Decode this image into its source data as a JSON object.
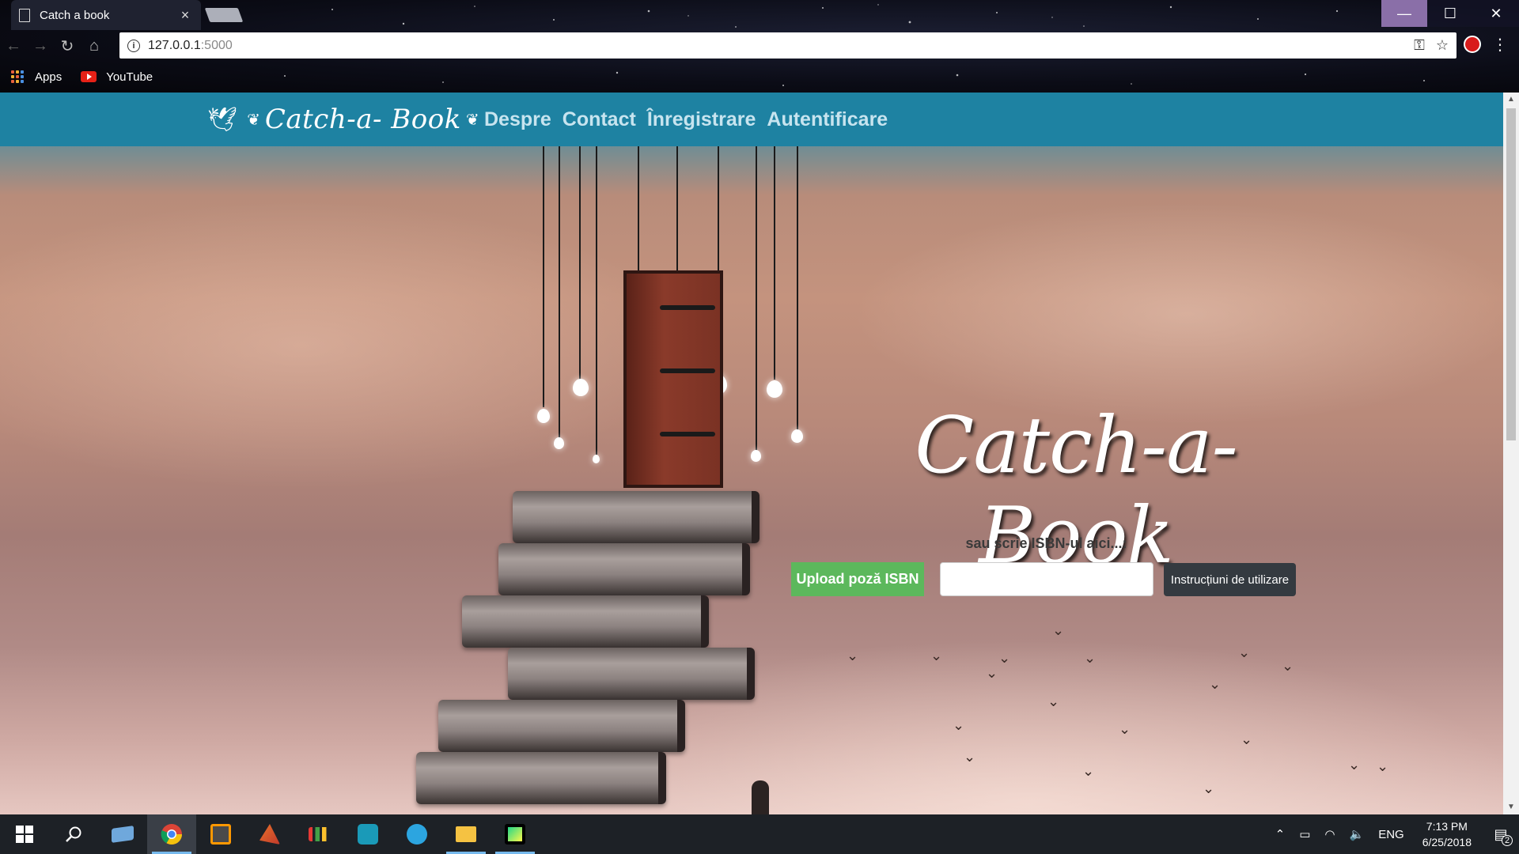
{
  "browser": {
    "tab_title": "Catch a book",
    "tab_close": "×",
    "url_host": "127.0.0.1",
    "url_port": ":5000",
    "window_controls": {
      "minimize": "—",
      "maximize": "☐",
      "close": "✕"
    },
    "bookmarks": [
      {
        "label": "Apps",
        "icon": "apps-grid-icon"
      },
      {
        "label": "YouTube",
        "icon": "youtube-icon"
      }
    ]
  },
  "site": {
    "logo_text": "Catch-a- Book",
    "nav": [
      "Despre",
      "Contact",
      "Înregistrare",
      "Autentificare"
    ],
    "hero_title": "Catch-a-Book",
    "isbn_hint": "sau scrie ISBN-ul aici...:",
    "upload_button": "Upload poză ISBN",
    "isbn_input_value": "",
    "help_button": "Instrucțiuni de utilizare"
  },
  "taskbar": {
    "apps": [
      "start",
      "search",
      "task-view",
      "chrome",
      "sublime-text",
      "matlab",
      "chart-app",
      "instagram",
      "telegram",
      "file-explorer",
      "pycharm"
    ],
    "language": "ENG",
    "time": "7:13 PM",
    "date": "6/25/2018",
    "notification_count": "2"
  },
  "colors": {
    "navbar": "#1e82a2",
    "upload_button": "#5cb85c",
    "help_button": "#343a40",
    "taskbar": "#1d2126"
  }
}
